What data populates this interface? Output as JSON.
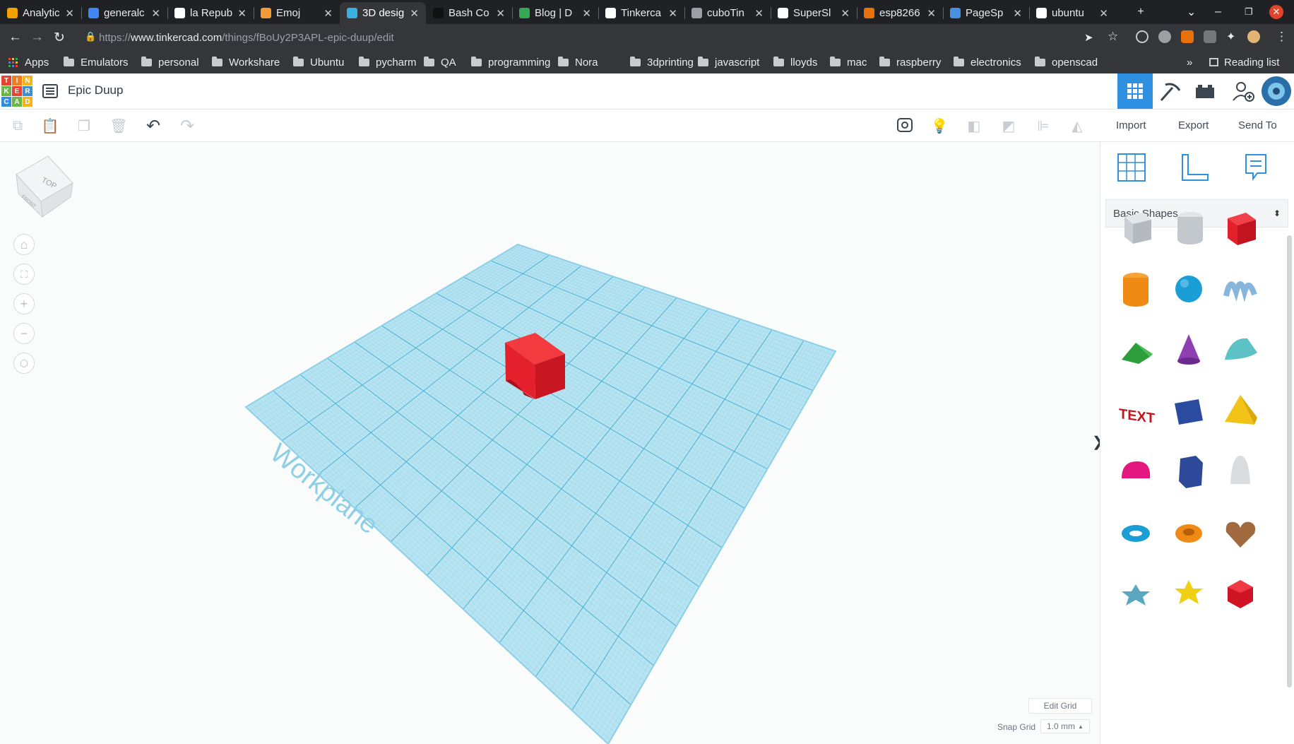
{
  "tabs": [
    {
      "title": "Analytic",
      "favicon_color": "#f4a200",
      "active": false
    },
    {
      "title": "generalc",
      "favicon_color": "#4285f4",
      "active": false
    },
    {
      "title": "la Repub",
      "favicon_color": "#ffffff",
      "active": false
    },
    {
      "title": "Emoj",
      "favicon_color": "#f29a38",
      "active": false
    },
    {
      "title": "3D desig",
      "favicon_color": "#3ab0e2",
      "active": true
    },
    {
      "title": "Bash Co",
      "favicon_color": "#111111",
      "active": false
    },
    {
      "title": "Blog | D",
      "favicon_color": "#34a853",
      "active": false
    },
    {
      "title": "Tinkerca",
      "favicon_color": "#ffffff",
      "active": false
    },
    {
      "title": "cuboTin",
      "favicon_color": "#9aa0a6",
      "active": false
    },
    {
      "title": "SuperSl",
      "favicon_color": "#ffffff",
      "active": false
    },
    {
      "title": "esp8266",
      "favicon_color": "#e8710a",
      "active": false
    },
    {
      "title": "PageSp",
      "favicon_color": "#4a90e2",
      "active": false
    },
    {
      "title": "ubuntu",
      "favicon_color": "#ffffff",
      "active": false
    }
  ],
  "browser": {
    "url_scheme": "https://",
    "url_host": "www.tinkercad.com",
    "url_path": "/things/fBoUy2P3APL-epic-duup/edit",
    "reading_list_label": "Reading list",
    "bookmarks_overflow": "»"
  },
  "bookmarks": [
    {
      "label": "Apps",
      "type": "apps"
    },
    {
      "label": "Emulators",
      "type": "folder"
    },
    {
      "label": "personal",
      "type": "folder"
    },
    {
      "label": "Workshare",
      "type": "folder"
    },
    {
      "label": "Ubuntu",
      "type": "folder"
    },
    {
      "label": "pycharm",
      "type": "folder"
    },
    {
      "label": "QA",
      "type": "folder"
    },
    {
      "label": "programming",
      "type": "folder"
    },
    {
      "label": "Nora",
      "type": "folder"
    },
    {
      "label": "3dprinting",
      "type": "folder"
    },
    {
      "label": "javascript",
      "type": "folder"
    },
    {
      "label": "lloyds",
      "type": "folder"
    },
    {
      "label": "mac",
      "type": "folder"
    },
    {
      "label": "raspberry",
      "type": "folder"
    },
    {
      "label": "electronics",
      "type": "folder"
    },
    {
      "label": "openscad",
      "type": "folder"
    }
  ],
  "app": {
    "logo_letters": [
      "T",
      "I",
      "N",
      "K",
      "E",
      "R",
      "C",
      "A",
      "D"
    ],
    "design_title": "Epic Duup"
  },
  "toolbar": {
    "import_label": "Import",
    "export_label": "Export",
    "sendto_label": "Send To"
  },
  "viewcube": {
    "top_label": "TOP",
    "front_label": "FRONT"
  },
  "workplane": {
    "label": "Workplane"
  },
  "panel": {
    "shape_category": "Basic Shapes",
    "collapse_arrow": "❯",
    "shapes": [
      "box-hole",
      "cylinder-hole",
      "box",
      "cylinder",
      "sphere",
      "scribble",
      "roof",
      "cone",
      "round-roof",
      "text",
      "wedge",
      "pyramid",
      "half-sphere",
      "polygon",
      "paraboloid",
      "torus",
      "tube",
      "heart",
      "star",
      "star-gold",
      "icosahedron"
    ]
  },
  "grid": {
    "edit_grid_label": "Edit Grid",
    "snap_grid_label": "Snap Grid",
    "snap_value": "1.0 mm"
  },
  "colors": {
    "accent": "#2f8fe0",
    "workplane": "#a5dcef",
    "cube": "#e3202c"
  }
}
